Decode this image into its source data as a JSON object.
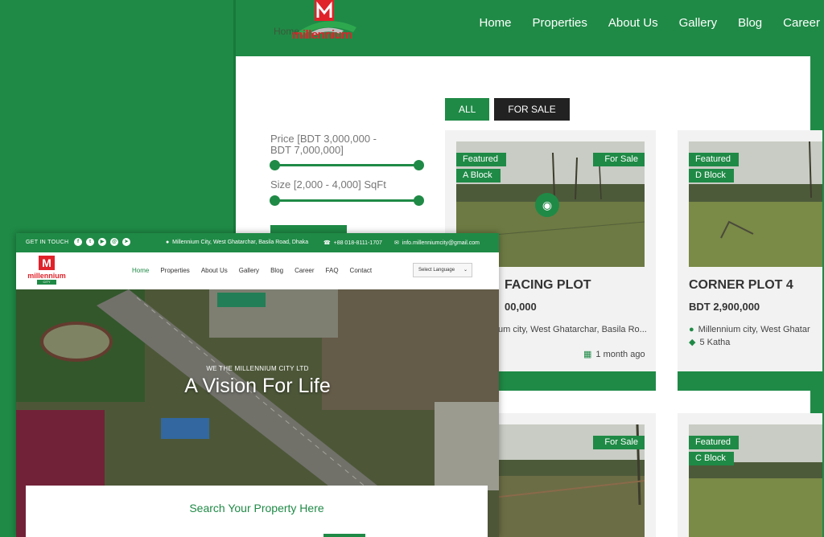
{
  "back": {
    "logo": {
      "ghost_text": "Home",
      "word": "millennium"
    },
    "nav": [
      "Home",
      "Properties",
      "About Us",
      "Gallery",
      "Blog",
      "Career"
    ],
    "filters": {
      "all_label": "ALL",
      "for_sale_label": "FOR SALE"
    },
    "price_label": "Price [BDT 3,000,000 - BDT 7,000,000]",
    "size_label": "Size [2,000 - 4,000] SqFt",
    "cards": [
      {
        "featured": "Featured",
        "status": "For Sale",
        "block": "A Block",
        "title": "FACING PLOT",
        "price": "00,000",
        "location": "um city, West Ghatarchar, Basila Ro...",
        "time": "1 month ago"
      },
      {
        "featured": "Featured",
        "block": "D Block",
        "title": "CORNER PLOT 4",
        "price": "BDT 2,900,000",
        "location": "Millennium city, West Ghatar",
        "size": "5 Katha"
      },
      {
        "status": "For Sale"
      },
      {
        "featured": "Featured",
        "block": "C Block"
      }
    ]
  },
  "front": {
    "topbar": {
      "get_in_touch": "GET IN TOUCH",
      "socials": [
        "facebook-icon",
        "twitter-icon",
        "youtube-icon",
        "mail-icon",
        "telegram-icon"
      ],
      "address": "Millennium City, West Ghatarchar, Basila Road, Dhaka",
      "phone": "+88 018-8111-1707",
      "email": "info.millenniumcity@gmail.com"
    },
    "logo": {
      "mark": "M",
      "word": "millennium",
      "city": "CITY"
    },
    "nav": [
      "Home",
      "Properties",
      "About Us",
      "Gallery",
      "Blog",
      "Career",
      "FAQ",
      "Contact"
    ],
    "language": "Select Language",
    "hero": {
      "subtitle": "WE THE MILLENNIUM CITY LTD",
      "title": "A Vision For Life"
    },
    "search_title": "Search Your Property Here"
  },
  "colors": {
    "brand_green": "#1f8a46",
    "logo_red": "#e0222a",
    "dark": "#222222"
  }
}
